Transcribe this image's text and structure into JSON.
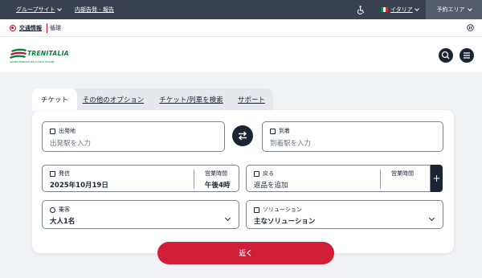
{
  "topbar": {
    "group_sites": "グループサイト",
    "internal_report": "内部告発 - 報告",
    "language": "イタリア",
    "reserved_area": "予約エリア"
  },
  "infobar": {
    "traffic_info": "交通情報",
    "status": "循環"
  },
  "header": {
    "logo_name": "TRENITALIA",
    "logo_sub": "GRUPPO FERROVIE DELLO STATO ITALIANE"
  },
  "tabs": [
    {
      "label": "チケット"
    },
    {
      "label": "その他のオプション"
    },
    {
      "label": "チケット/列車を検索"
    },
    {
      "label": "サポート"
    }
  ],
  "form": {
    "departure": {
      "label": "出発地",
      "placeholder": "出発駅を入力"
    },
    "arrival": {
      "label": "到着",
      "placeholder": "到着駅を入力"
    },
    "depart_date": {
      "label": "発信",
      "value": "2025年10月19日",
      "time_label": "営業時間",
      "time_value": "午後4時"
    },
    "return_date": {
      "label": "戻る",
      "value": "返品を追加",
      "time_label": "営業時間"
    },
    "passengers": {
      "label": "乗客",
      "value": "大人1名"
    },
    "solution": {
      "label": "ソリューション",
      "value": "主なソリューション"
    },
    "submit": "近く",
    "plus": "+"
  },
  "colors": {
    "topbar": "#39404f",
    "accent_red": "#d11f37",
    "dark": "#1b2433",
    "logo_green": "#00823b"
  }
}
